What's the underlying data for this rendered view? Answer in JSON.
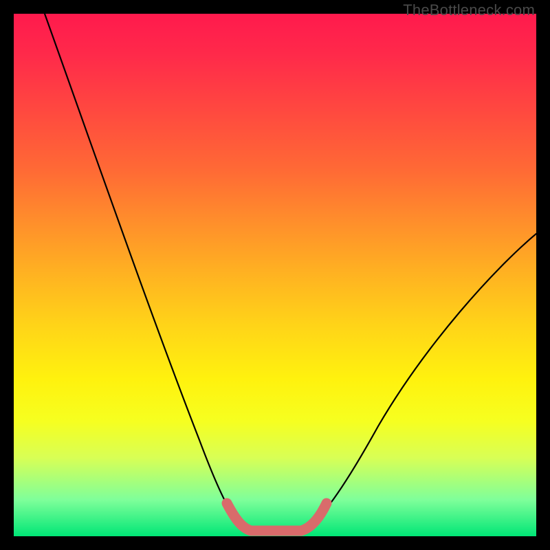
{
  "watermark": "TheBottleneck.com",
  "chart_data": {
    "type": "line",
    "title": "",
    "xlabel": "",
    "ylabel": "",
    "xlim": [
      0,
      100
    ],
    "ylim": [
      0,
      100
    ],
    "grid": false,
    "series": [
      {
        "name": "bottleneck-curve",
        "values": [
          {
            "x": 6,
            "y": 100
          },
          {
            "x": 15,
            "y": 74
          },
          {
            "x": 25,
            "y": 46
          },
          {
            "x": 33,
            "y": 24
          },
          {
            "x": 40,
            "y": 8
          },
          {
            "x": 44,
            "y": 1
          },
          {
            "x": 50,
            "y": 0
          },
          {
            "x": 56,
            "y": 1
          },
          {
            "x": 62,
            "y": 8
          },
          {
            "x": 70,
            "y": 20
          },
          {
            "x": 80,
            "y": 35
          },
          {
            "x": 90,
            "y": 48
          },
          {
            "x": 100,
            "y": 58
          }
        ],
        "color": "#000000"
      },
      {
        "name": "optimal-zone-marker",
        "values": [
          {
            "x": 42,
            "y": 4
          },
          {
            "x": 44,
            "y": 1
          },
          {
            "x": 50,
            "y": 0
          },
          {
            "x": 56,
            "y": 1
          },
          {
            "x": 58,
            "y": 4
          }
        ],
        "color": "#d96b6b"
      }
    ],
    "background_gradient": {
      "top": "#ff1a4d",
      "middle": "#fff20e",
      "bottom": "#00e676"
    }
  }
}
